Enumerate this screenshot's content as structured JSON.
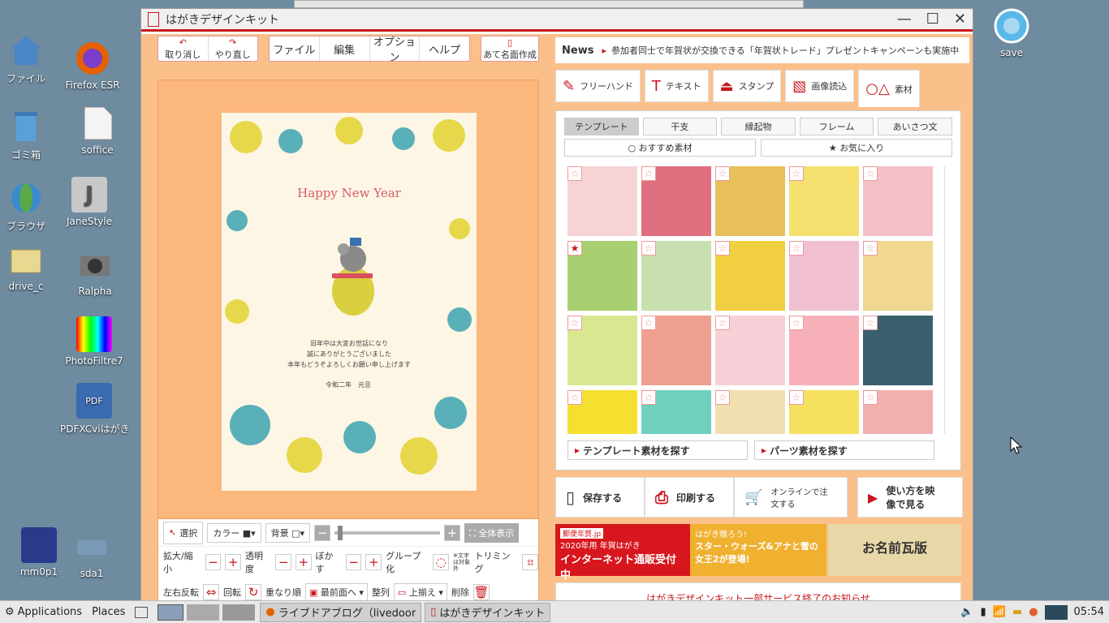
{
  "desktop": {
    "icons": [
      {
        "label": "ファイル"
      },
      {
        "label": "Firefox ESR"
      },
      {
        "label": "ゴミ箱"
      },
      {
        "label": "soffice"
      },
      {
        "label": "ブラウザ"
      },
      {
        "label": "JaneStyle"
      },
      {
        "label": "drive_c"
      },
      {
        "label": "Ralpha"
      },
      {
        "label": "PhotoFiltre7"
      },
      {
        "label": "PDFXCviはがき"
      },
      {
        "label": "mm0p1"
      },
      {
        "label": "sda1"
      },
      {
        "label": "save"
      }
    ]
  },
  "window": {
    "title": "はがきデザインキット",
    "controls": {
      "minimize": "—",
      "maximize": "☐",
      "close": "✕"
    }
  },
  "toolbar": {
    "undo": "取り消し",
    "redo": "やり直し",
    "menu": [
      "ファイル",
      "編集",
      "オプション",
      "ヘルプ"
    ],
    "address": "あて名面作成"
  },
  "news": {
    "label": "News",
    "text": "参加者同士で年賀状が交換できる「年賀状トレード」プレゼントキャンペーンも実施中"
  },
  "card": {
    "greeting": "Happy New Year",
    "message": [
      "旧年中は大変お世話になり",
      "誠にありがとうございました",
      "本年もどうぞよろしくお願い申し上げます"
    ],
    "date": "令和二年　元旦"
  },
  "controls": {
    "select": "選択",
    "color": "カラー",
    "background": "背景",
    "fullview": "全体表示",
    "scale": "拡大/縮小",
    "opacity": "透明度",
    "blur": "ぼかす",
    "group": "グループ化",
    "group_note": "※文字は対象外",
    "trim": "トリミング",
    "flip": "左右反転",
    "rotate": "回転",
    "order": "重なり順",
    "order_value": "最前面へ",
    "align": "整列",
    "align_value": "上揃え",
    "delete": "削除"
  },
  "tools": [
    "フリーハンド",
    "テキスト",
    "スタンプ",
    "画像読込",
    "素材"
  ],
  "materials": {
    "tabs": [
      "テンプレート",
      "干支",
      "縁起物",
      "フレーム",
      "あいさつ文"
    ],
    "subtabs": [
      "おすすめ素材",
      "お気に入り"
    ],
    "find_template": "テンプレート素材を探す",
    "find_parts": "パーツ素材を探す",
    "thumbs": [
      {
        "color": "#f6d4d6",
        "fav": false
      },
      {
        "color": "#e07080",
        "fav": false
      },
      {
        "color": "#e8c05a",
        "fav": false
      },
      {
        "color": "#f5e070",
        "fav": false
      },
      {
        "color": "#f4c0c8",
        "fav": false
      },
      {
        "color": "#a8d070",
        "fav": true
      },
      {
        "color": "#c8e0b0",
        "fav": false
      },
      {
        "color": "#f0d040",
        "fav": false
      },
      {
        "color": "#f0c0d0",
        "fav": false
      },
      {
        "color": "#f0d890",
        "fav": false
      },
      {
        "color": "#d8e890",
        "fav": false
      },
      {
        "color": "#f0a090",
        "fav": false
      },
      {
        "color": "#f8d0d8",
        "fav": false
      },
      {
        "color": "#f8b0b8",
        "fav": false
      },
      {
        "color": "#3a6070",
        "fav": false
      },
      {
        "color": "#f5e030",
        "fav": false
      },
      {
        "color": "#70d0c0",
        "fav": false
      },
      {
        "color": "#f0e0b0",
        "fav": false
      },
      {
        "color": "#f5e060",
        "fav": false
      },
      {
        "color": "#f0b0b0",
        "fav": false
      }
    ]
  },
  "actions": {
    "save": "保存する",
    "print": "印刷する",
    "order": "オンラインで注文する",
    "howto": "使い方を映像で見る"
  },
  "banners": [
    {
      "line1": "郵便年賀.jp",
      "line2": "2020年用 年賀はがき",
      "line3": "インターネット通販受付中"
    },
    {
      "line1": "はがき贈ろう!",
      "line2": "スター・ウォーズ&アナと雪の女王2が登場!"
    },
    {
      "line1": "お名前瓦版"
    }
  ],
  "notice": "はがきデザインキット一部サービス終了のお知らせ",
  "taskbar": {
    "apps": "Applications",
    "places": "Places",
    "task1": "ライブドアブログ（livedoor",
    "task2": "はがきデザインキット",
    "clock": "05:54"
  },
  "colors": {
    "accent": "#c8161d",
    "canvas": "#fbc08a"
  }
}
